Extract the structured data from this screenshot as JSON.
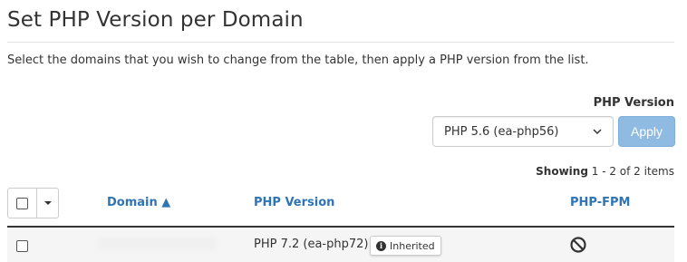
{
  "page": {
    "title": "Set PHP Version per Domain",
    "description": "Select the domains that you wish to change from the table, then apply a PHP version from the list."
  },
  "version_picker": {
    "label": "PHP Version",
    "selected": "PHP 5.6 (ea-php56)",
    "apply_label": "Apply"
  },
  "pagination": {
    "showing_label": "Showing",
    "range": "1 - 2 of 2 items"
  },
  "table": {
    "columns": {
      "domain": "Domain ▲",
      "php_version": "PHP Version",
      "php_fpm": "PHP-FPM"
    },
    "rows": [
      {
        "domain": "",
        "php_version": "PHP 7.2 (ea-php72)",
        "badge": "Inherited",
        "php_fpm_icon": "ban-icon"
      }
    ]
  },
  "colors": {
    "link_blue": "#2f74b5",
    "apply_button_bg": "#8fbbe2",
    "row_bg": "#f5f5f5"
  }
}
